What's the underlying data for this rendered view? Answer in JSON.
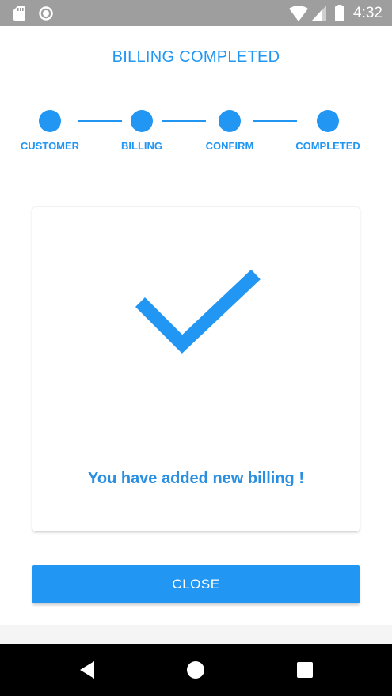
{
  "status_bar": {
    "time": "4:32",
    "icons": [
      "sd-card-icon",
      "record-icon",
      "wifi-icon",
      "signal-icon",
      "battery-icon"
    ]
  },
  "header": {
    "title": "BILLING COMPLETED"
  },
  "stepper": {
    "steps": [
      {
        "label": "CUSTOMER"
      },
      {
        "label": "BILLING"
      },
      {
        "label": "CONFIRM"
      },
      {
        "label": "COMPLETED"
      }
    ]
  },
  "card": {
    "icon": "checkmark-icon",
    "message": "You have added new billing !"
  },
  "actions": {
    "close_label": "CLOSE"
  },
  "nav_bar": {
    "buttons": [
      "back-icon",
      "home-icon",
      "recents-icon"
    ]
  },
  "colors": {
    "accent": "#2196f3",
    "status_bar": "#9e9e9e",
    "nav_bar": "#000000",
    "background": "#ffffff"
  }
}
